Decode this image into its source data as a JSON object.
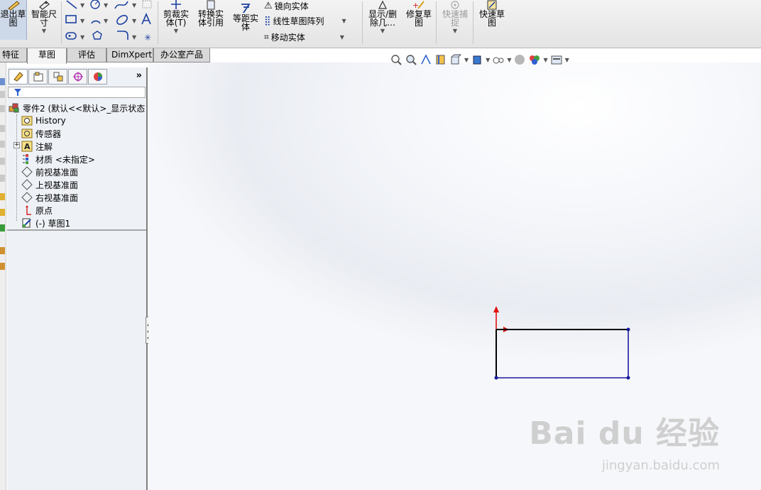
{
  "ribbon": {
    "exit_sketch_label": "退出草\n图",
    "smart_dimension_label": "智能尺\n寸",
    "trim_label": "剪裁实\n体(T)",
    "convert_label": "转换实\n体引用",
    "offset_label": "等距实\n体",
    "mirror_label": "镜向实体",
    "linear_pattern_label": "线性草图阵列",
    "move_label": "移动实体",
    "display_delete_label": "显示/删\n除几…",
    "repair_label": "修复草\n图",
    "quick_snap_label": "快速捕\n捉",
    "rapid_sketch_label": "快速草\n图"
  },
  "tabs": [
    {
      "label": "特征",
      "active": false
    },
    {
      "label": "草图",
      "active": true
    },
    {
      "label": "评估",
      "active": false
    },
    {
      "label": "DimXpert",
      "active": false
    },
    {
      "label": "办公室产品",
      "active": false
    }
  ],
  "feature_manager": {
    "expand_label": "»",
    "root": "零件2  (默认<<默认>_显示状态",
    "items": [
      {
        "label": "History",
        "icon": "history-icon"
      },
      {
        "label": "传感器",
        "icon": "sensor-icon"
      },
      {
        "label": "注解",
        "icon": "annotation-icon"
      },
      {
        "label": "材质 <未指定>",
        "icon": "material-icon"
      },
      {
        "label": "前视基准面",
        "icon": "plane-icon"
      },
      {
        "label": "上视基准面",
        "icon": "plane-icon"
      },
      {
        "label": "右视基准面",
        "icon": "plane-icon"
      },
      {
        "label": "原点",
        "icon": "origin-icon"
      },
      {
        "label": "(-) 草图1",
        "icon": "sketch-icon"
      }
    ]
  },
  "watermark": {
    "main": "Bai du 经验",
    "sub": "jingyan.baidu.com"
  },
  "colors": {
    "sketch_line": "#1a1a9e",
    "selected_edge": "#000000",
    "origin_red": "#e01010"
  }
}
